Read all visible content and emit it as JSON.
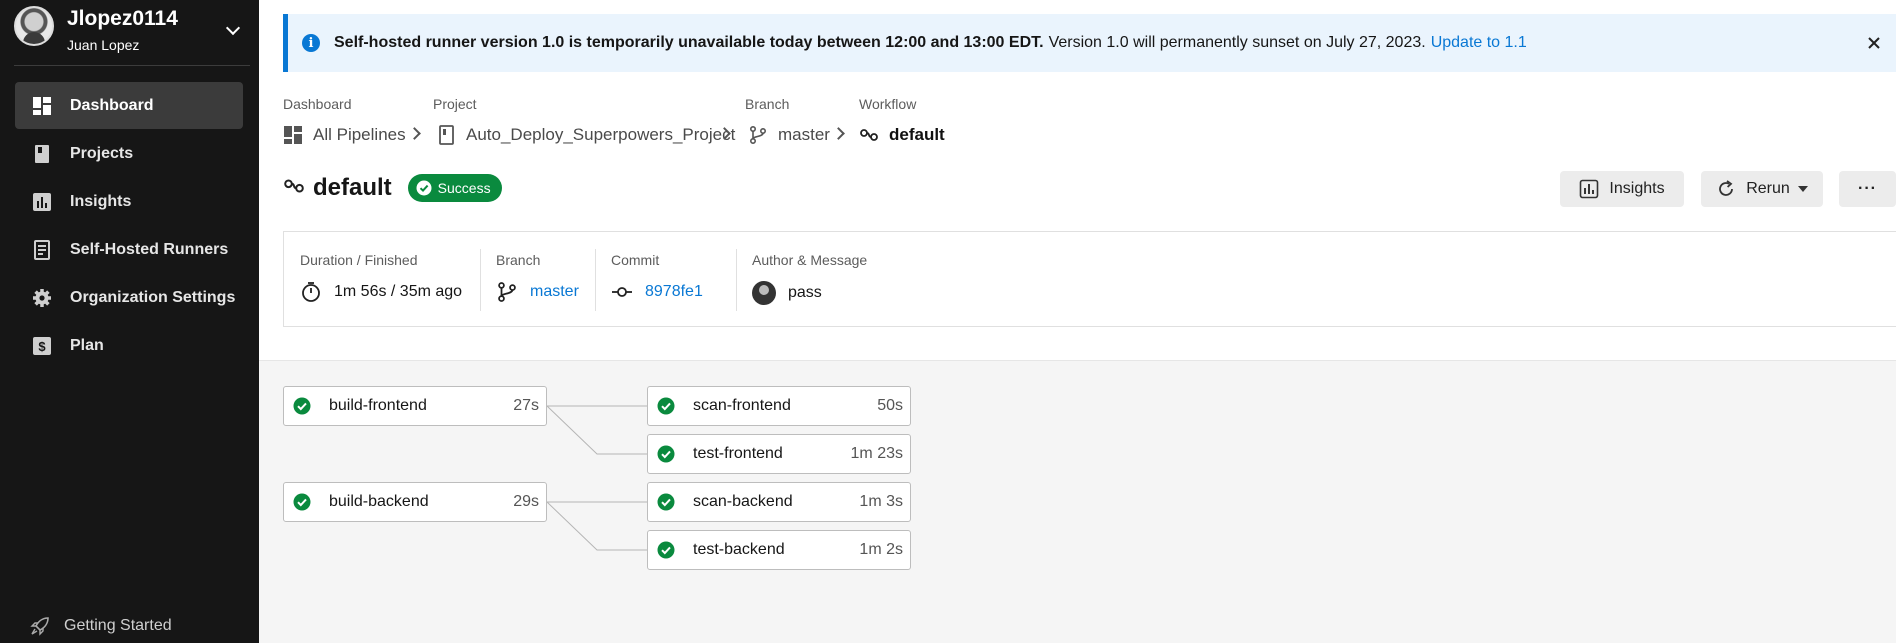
{
  "user": {
    "username": "Jlopez0114",
    "name": "Juan Lopez"
  },
  "nav": {
    "items": [
      {
        "label": "Dashboard",
        "icon": "dashboard-icon",
        "active": true
      },
      {
        "label": "Projects",
        "icon": "book-icon"
      },
      {
        "label": "Insights",
        "icon": "insights-icon"
      },
      {
        "label": "Self-Hosted Runners",
        "icon": "runner-icon"
      },
      {
        "label": "Organization Settings",
        "icon": "gear-icon"
      },
      {
        "label": "Plan",
        "icon": "dollar-icon"
      }
    ],
    "getting_started": "Getting Started"
  },
  "banner": {
    "bold_text": "Self-hosted runner version 1.0 is temporarily unavailable today between 12:00 and 13:00 EDT.",
    "text": "Version 1.0 will permanently sunset on July 27, 2023.",
    "link": "Update to 1.1"
  },
  "breadcrumb": {
    "dashboard_label": "Dashboard",
    "dashboard_value": "All Pipelines",
    "project_label": "Project",
    "project_value": "Auto_Deploy_Superpowers_Project",
    "branch_label": "Branch",
    "branch_value": "master",
    "workflow_label": "Workflow",
    "workflow_value": "default"
  },
  "header": {
    "title": "default",
    "status": "Success",
    "insights_button": "Insights",
    "rerun_button": "Rerun",
    "more_button": "···"
  },
  "summary": {
    "duration_label": "Duration / Finished",
    "duration_value": "1m 56s / 35m ago",
    "branch_label": "Branch",
    "branch_value": "master",
    "commit_label": "Commit",
    "commit_value": "8978fe1",
    "author_label": "Author & Message",
    "author_message": "pass"
  },
  "jobs": [
    {
      "name": "build-frontend",
      "duration": "27s"
    },
    {
      "name": "scan-frontend",
      "duration": "50s"
    },
    {
      "name": "test-frontend",
      "duration": "1m 23s"
    },
    {
      "name": "build-backend",
      "duration": "29s"
    },
    {
      "name": "scan-backend",
      "duration": "1m 3s"
    },
    {
      "name": "test-backend",
      "duration": "1m 2s"
    }
  ],
  "colors": {
    "accent": "#0978d4",
    "success": "#0a8a3e",
    "sidebar": "#161616"
  }
}
